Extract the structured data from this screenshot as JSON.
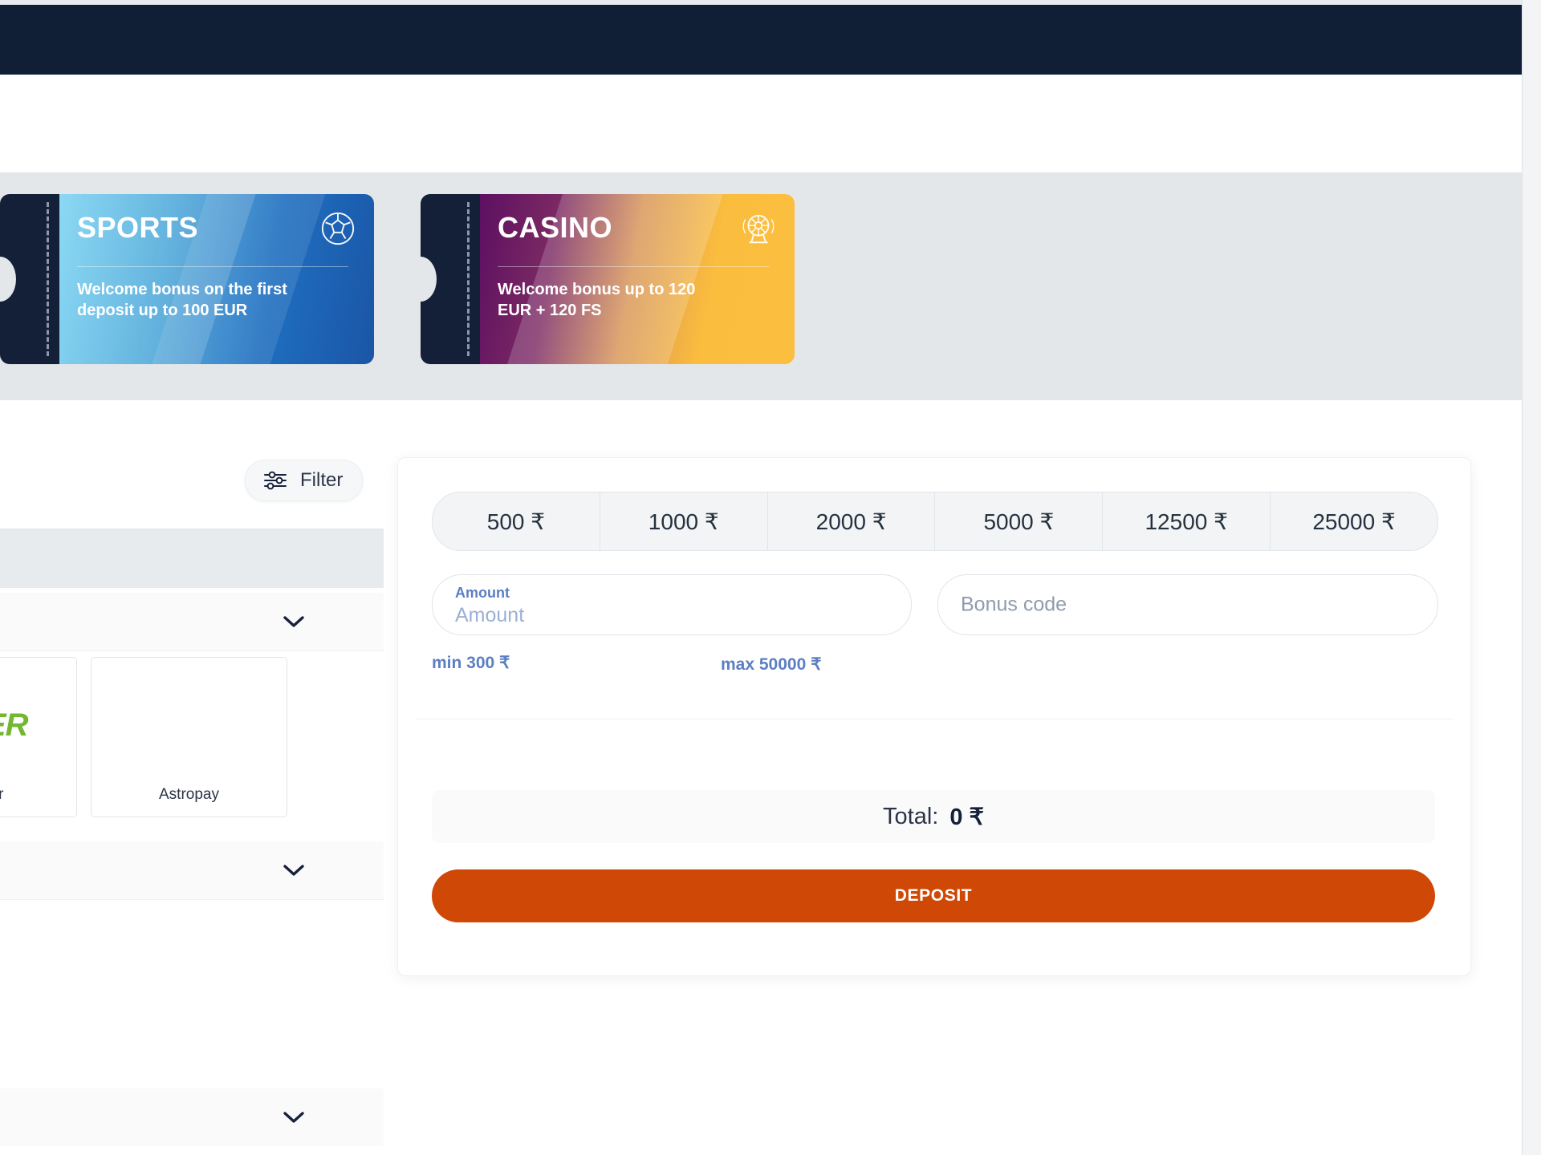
{
  "header": {
    "nav_bar_color": "#101f35"
  },
  "bonus_banner": {
    "background": "#e3e7ea",
    "tickets": [
      {
        "id": "sports",
        "title": "SPORTS",
        "description": "Welcome bonus on the first deposit up to 100 EUR",
        "icon": "soccer-ball-icon",
        "accent": "#1f6fc0"
      },
      {
        "id": "casino",
        "title": "CASINO",
        "description": "Welcome bonus up to 120 EUR + 120 FS",
        "icon": "roulette-wheel-icon",
        "accent": "#fbbd3e"
      }
    ]
  },
  "filter": {
    "label": "Filter",
    "icon": "sliders-icon"
  },
  "payment_panel": {
    "methods": [
      {
        "logo_text": "LER",
        "label": "er"
      },
      {
        "logo_text": "",
        "label": "Astropay"
      }
    ],
    "accordion_rows": [
      {
        "icon": "chevron-down-icon"
      },
      {
        "icon": "chevron-down-icon"
      },
      {
        "icon": "chevron-down-icon"
      }
    ]
  },
  "deposit": {
    "presets": [
      "500 ₹",
      "1000 ₹",
      "2000 ₹",
      "5000 ₹",
      "12500 ₹",
      "25000 ₹"
    ],
    "amount_field": {
      "label": "Amount",
      "value": "Amount"
    },
    "bonus_field": {
      "placeholder": "Bonus code"
    },
    "min_hint": "min 300 ₹",
    "max_hint": "max 50000 ₹",
    "total_label": "Total:",
    "total_value": "0 ₹",
    "submit_label": "DEPOSIT",
    "submit_color": "#cf4806"
  }
}
